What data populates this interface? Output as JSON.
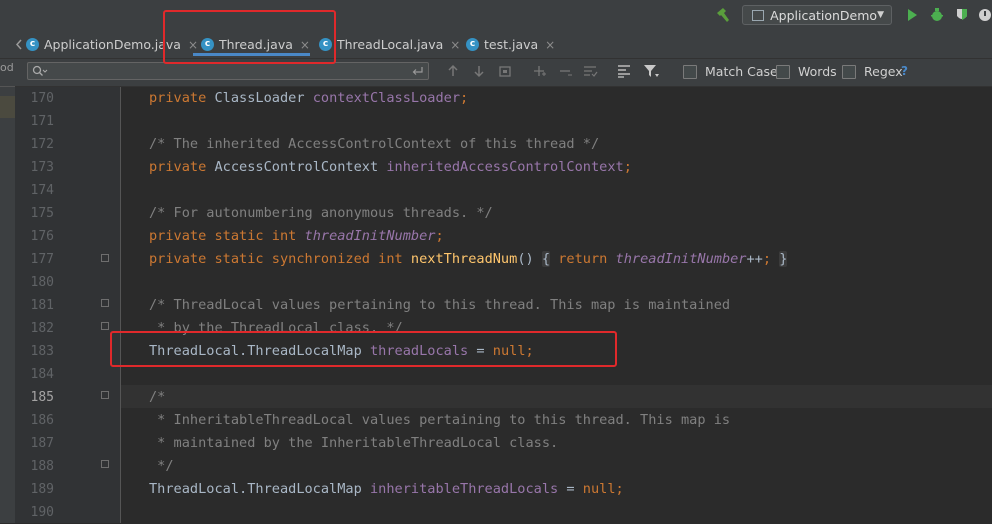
{
  "toolbar": {
    "run_config_label": "ApplicationDemo",
    "colors": {
      "build": "#5a9e3c",
      "run": "#4caf50",
      "debug": "#4caf50"
    }
  },
  "tabs": [
    {
      "label": "ApplicationDemo.java",
      "icon": "c",
      "close": "×"
    },
    {
      "label": "Thread.java",
      "icon": "c",
      "close": "×"
    },
    {
      "label": "ThreadLocal.java",
      "icon": "c",
      "close": "×"
    },
    {
      "label": "test.java",
      "icon": "c",
      "close": "×"
    }
  ],
  "left_strip_label": "od",
  "find": {
    "search_placeholder": "",
    "match_case_label": "Match Case",
    "words_label": "Words",
    "regex_label": "Regex",
    "help_label": "?"
  },
  "lines": [
    {
      "num": "170",
      "seg": [
        "private",
        " ClassLoader ",
        "contextClassLoader",
        ";"
      ]
    },
    {
      "num": "171",
      "seg": []
    },
    {
      "num": "172",
      "seg": [
        "/* The inherited AccessControlContext of this thread */"
      ]
    },
    {
      "num": "173",
      "seg": [
        "private",
        " AccessControlContext ",
        "inheritedAccessControlContext",
        ";"
      ]
    },
    {
      "num": "174",
      "seg": []
    },
    {
      "num": "175",
      "seg": [
        "/* For autonumbering anonymous threads. */"
      ]
    },
    {
      "num": "176",
      "seg": [
        "private static int",
        " ",
        "threadInitNumber",
        ";"
      ]
    },
    {
      "num": "177",
      "seg": [
        "private static synchronized int",
        " ",
        "nextThreadNum",
        "() ",
        "{",
        " ",
        "return",
        " ",
        "threadInitNumber",
        "++",
        ";",
        " ",
        "}"
      ]
    },
    {
      "num": "180",
      "seg": []
    },
    {
      "num": "181",
      "seg": [
        "/* ThreadLocal values pertaining to this thread. This map is maintained"
      ]
    },
    {
      "num": "182",
      "seg": [
        " * by the ThreadLocal class. */"
      ]
    },
    {
      "num": "183",
      "seg": [
        "ThreadLocal.ThreadLocalMap ",
        "threadLocals",
        " = ",
        "null",
        ";"
      ]
    },
    {
      "num": "184",
      "seg": []
    },
    {
      "num": "185",
      "seg": [
        "/*"
      ]
    },
    {
      "num": "186",
      "seg": [
        " * InheritableThreadLocal values pertaining to this thread. This map is"
      ]
    },
    {
      "num": "187",
      "seg": [
        " * maintained by the InheritableThreadLocal class."
      ]
    },
    {
      "num": "188",
      "seg": [
        " */"
      ]
    },
    {
      "num": "189",
      "seg": [
        "ThreadLocal.ThreadLocalMap ",
        "inheritableThreadLocals",
        " = ",
        "null",
        ";"
      ]
    },
    {
      "num": "190",
      "seg": []
    }
  ]
}
